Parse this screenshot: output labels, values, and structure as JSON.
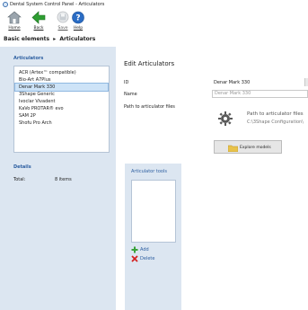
{
  "window": {
    "title": "Dental System Control Panel - Articulators"
  },
  "toolbar": {
    "home_label": "Home",
    "back_label": "Back",
    "save_label": "Save",
    "help_label": "Help"
  },
  "breadcrumb": {
    "parent": "Basic elements",
    "separator": "▸",
    "current": "Articulators"
  },
  "articulators_panel": {
    "title": "Articulators",
    "items": [
      {
        "label": "ACR (Artex™ compatible)",
        "selected": false
      },
      {
        "label": "Bio-Art A7Plus",
        "selected": false
      },
      {
        "label": "Denar Mark 330",
        "selected": true
      },
      {
        "label": "3Shape Generic",
        "selected": false
      },
      {
        "label": "Ivoclar Vivadent",
        "selected": false
      },
      {
        "label": "KaVo PROTAR® evo",
        "selected": false
      },
      {
        "label": "SAM 2P",
        "selected": false
      },
      {
        "label": "Shofu Pro Arch",
        "selected": false
      }
    ]
  },
  "details": {
    "title": "Details",
    "total_label": "Total:",
    "total_value": "8 items"
  },
  "edit": {
    "title": "Edit Articulators",
    "id_label": "ID",
    "id_value": "Denar Mark 330",
    "name_label": "Name",
    "name_value": "Denar Mark 330",
    "path_label": "Path to articulator files",
    "path_title": "Path to articulator files",
    "path_value": "C:\\3Shape Configuration\\",
    "explore_label": "Explore models"
  },
  "articulator_tools": {
    "title": "Articulator tools",
    "add_label": "Add",
    "delete_label": "Delete"
  },
  "colors": {
    "panel_bg": "#dce6f1",
    "accent_blue": "#2c5ea0",
    "selection": "#cde3f7",
    "add_green": "#3aa23a",
    "delete_red": "#d42020"
  }
}
